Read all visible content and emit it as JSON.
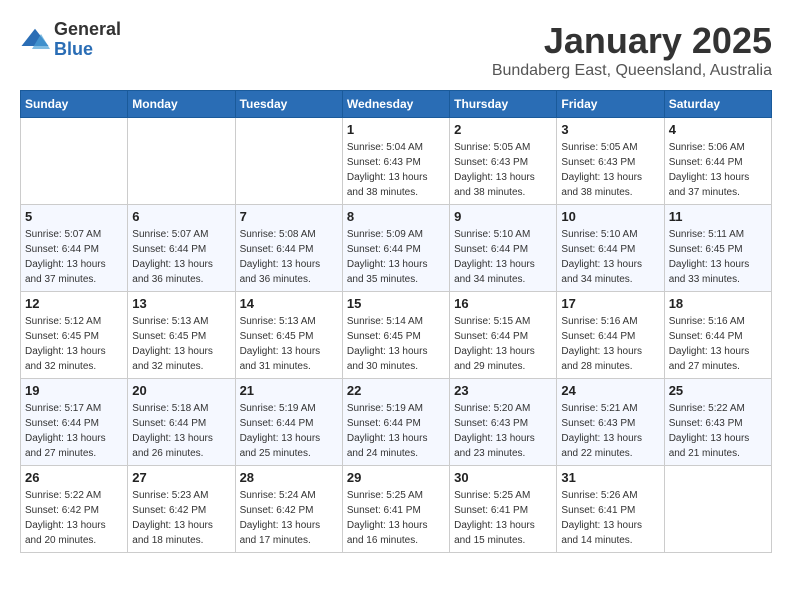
{
  "header": {
    "logo_general": "General",
    "logo_blue": "Blue",
    "month_title": "January 2025",
    "location": "Bundaberg East, Queensland, Australia"
  },
  "weekdays": [
    "Sunday",
    "Monday",
    "Tuesday",
    "Wednesday",
    "Thursday",
    "Friday",
    "Saturday"
  ],
  "weeks": [
    [
      {
        "day": "",
        "info": ""
      },
      {
        "day": "",
        "info": ""
      },
      {
        "day": "",
        "info": ""
      },
      {
        "day": "1",
        "info": "Sunrise: 5:04 AM\nSunset: 6:43 PM\nDaylight: 13 hours\nand 38 minutes."
      },
      {
        "day": "2",
        "info": "Sunrise: 5:05 AM\nSunset: 6:43 PM\nDaylight: 13 hours\nand 38 minutes."
      },
      {
        "day": "3",
        "info": "Sunrise: 5:05 AM\nSunset: 6:43 PM\nDaylight: 13 hours\nand 38 minutes."
      },
      {
        "day": "4",
        "info": "Sunrise: 5:06 AM\nSunset: 6:44 PM\nDaylight: 13 hours\nand 37 minutes."
      }
    ],
    [
      {
        "day": "5",
        "info": "Sunrise: 5:07 AM\nSunset: 6:44 PM\nDaylight: 13 hours\nand 37 minutes."
      },
      {
        "day": "6",
        "info": "Sunrise: 5:07 AM\nSunset: 6:44 PM\nDaylight: 13 hours\nand 36 minutes."
      },
      {
        "day": "7",
        "info": "Sunrise: 5:08 AM\nSunset: 6:44 PM\nDaylight: 13 hours\nand 36 minutes."
      },
      {
        "day": "8",
        "info": "Sunrise: 5:09 AM\nSunset: 6:44 PM\nDaylight: 13 hours\nand 35 minutes."
      },
      {
        "day": "9",
        "info": "Sunrise: 5:10 AM\nSunset: 6:44 PM\nDaylight: 13 hours\nand 34 minutes."
      },
      {
        "day": "10",
        "info": "Sunrise: 5:10 AM\nSunset: 6:44 PM\nDaylight: 13 hours\nand 34 minutes."
      },
      {
        "day": "11",
        "info": "Sunrise: 5:11 AM\nSunset: 6:45 PM\nDaylight: 13 hours\nand 33 minutes."
      }
    ],
    [
      {
        "day": "12",
        "info": "Sunrise: 5:12 AM\nSunset: 6:45 PM\nDaylight: 13 hours\nand 32 minutes."
      },
      {
        "day": "13",
        "info": "Sunrise: 5:13 AM\nSunset: 6:45 PM\nDaylight: 13 hours\nand 32 minutes."
      },
      {
        "day": "14",
        "info": "Sunrise: 5:13 AM\nSunset: 6:45 PM\nDaylight: 13 hours\nand 31 minutes."
      },
      {
        "day": "15",
        "info": "Sunrise: 5:14 AM\nSunset: 6:45 PM\nDaylight: 13 hours\nand 30 minutes."
      },
      {
        "day": "16",
        "info": "Sunrise: 5:15 AM\nSunset: 6:44 PM\nDaylight: 13 hours\nand 29 minutes."
      },
      {
        "day": "17",
        "info": "Sunrise: 5:16 AM\nSunset: 6:44 PM\nDaylight: 13 hours\nand 28 minutes."
      },
      {
        "day": "18",
        "info": "Sunrise: 5:16 AM\nSunset: 6:44 PM\nDaylight: 13 hours\nand 27 minutes."
      }
    ],
    [
      {
        "day": "19",
        "info": "Sunrise: 5:17 AM\nSunset: 6:44 PM\nDaylight: 13 hours\nand 27 minutes."
      },
      {
        "day": "20",
        "info": "Sunrise: 5:18 AM\nSunset: 6:44 PM\nDaylight: 13 hours\nand 26 minutes."
      },
      {
        "day": "21",
        "info": "Sunrise: 5:19 AM\nSunset: 6:44 PM\nDaylight: 13 hours\nand 25 minutes."
      },
      {
        "day": "22",
        "info": "Sunrise: 5:19 AM\nSunset: 6:44 PM\nDaylight: 13 hours\nand 24 minutes."
      },
      {
        "day": "23",
        "info": "Sunrise: 5:20 AM\nSunset: 6:43 PM\nDaylight: 13 hours\nand 23 minutes."
      },
      {
        "day": "24",
        "info": "Sunrise: 5:21 AM\nSunset: 6:43 PM\nDaylight: 13 hours\nand 22 minutes."
      },
      {
        "day": "25",
        "info": "Sunrise: 5:22 AM\nSunset: 6:43 PM\nDaylight: 13 hours\nand 21 minutes."
      }
    ],
    [
      {
        "day": "26",
        "info": "Sunrise: 5:22 AM\nSunset: 6:42 PM\nDaylight: 13 hours\nand 20 minutes."
      },
      {
        "day": "27",
        "info": "Sunrise: 5:23 AM\nSunset: 6:42 PM\nDaylight: 13 hours\nand 18 minutes."
      },
      {
        "day": "28",
        "info": "Sunrise: 5:24 AM\nSunset: 6:42 PM\nDaylight: 13 hours\nand 17 minutes."
      },
      {
        "day": "29",
        "info": "Sunrise: 5:25 AM\nSunset: 6:41 PM\nDaylight: 13 hours\nand 16 minutes."
      },
      {
        "day": "30",
        "info": "Sunrise: 5:25 AM\nSunset: 6:41 PM\nDaylight: 13 hours\nand 15 minutes."
      },
      {
        "day": "31",
        "info": "Sunrise: 5:26 AM\nSunset: 6:41 PM\nDaylight: 13 hours\nand 14 minutes."
      },
      {
        "day": "",
        "info": ""
      }
    ]
  ]
}
